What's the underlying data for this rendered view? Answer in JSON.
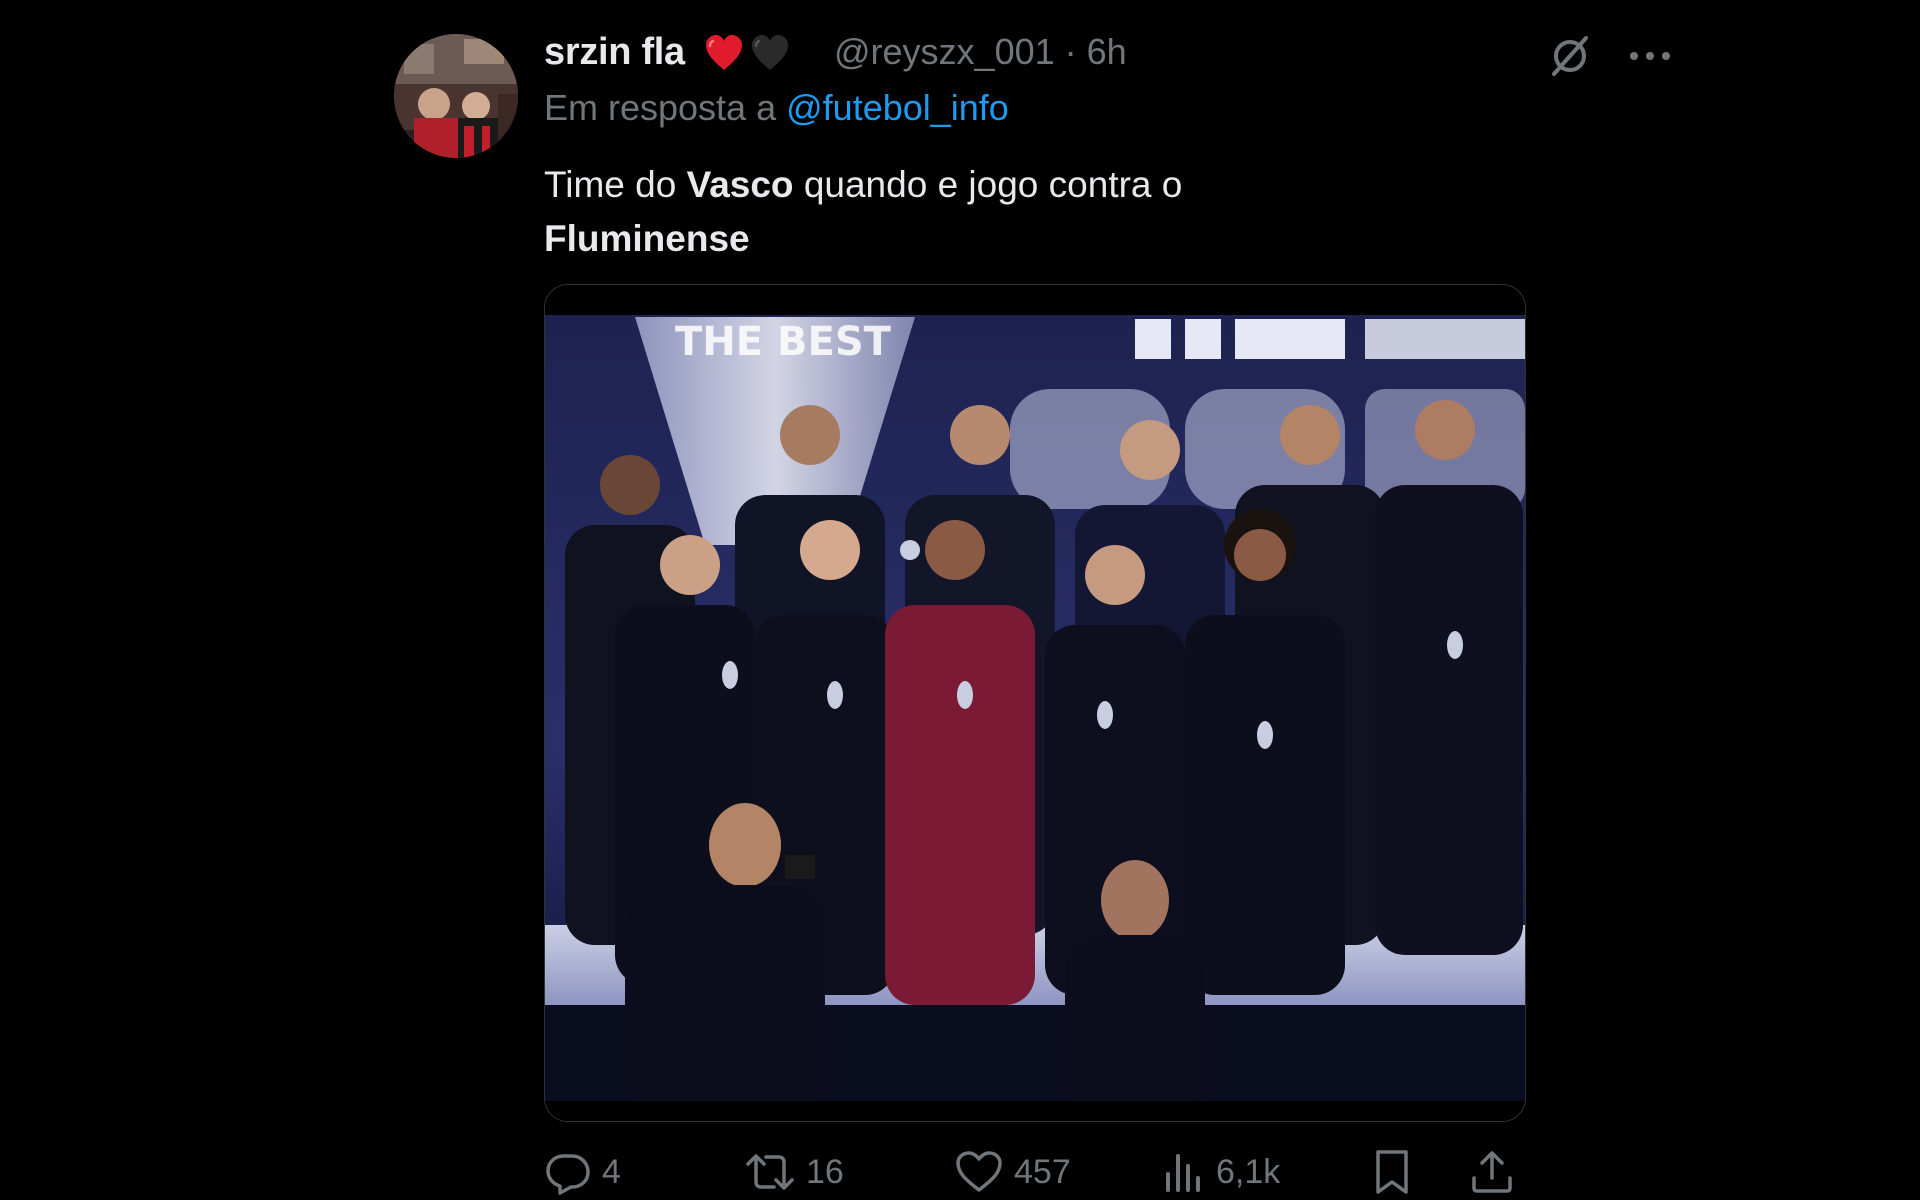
{
  "tweet": {
    "display_name": "srzin fla",
    "name_emojis": [
      "red-heart",
      "black-heart"
    ],
    "handle_time": "@reyszx_001 · 6h",
    "reply_prefix": "Em resposta a",
    "reply_to": "@futebol_info",
    "text": {
      "part1": "Time do ",
      "bold1": "Vasco",
      "part2": " quando e jogo contra o ",
      "bold2": "Fluminense"
    },
    "media": {
      "icon": "photo",
      "backdrop_text": "THE BEST"
    },
    "actions": {
      "reply_count": "4",
      "repost_count": "16",
      "like_count": "457",
      "views_count": "6,1k"
    }
  },
  "icons": {
    "reply": "reply-icon",
    "repost": "repost-icon",
    "like": "heart-icon",
    "views": "analytics-icon",
    "bookmark": "bookmark-icon",
    "share": "share-icon",
    "grok": "grok-icon",
    "more": "more-icon"
  },
  "colors": {
    "background": "#000000",
    "text": "#e7e9ea",
    "secondary": "#71767b",
    "link": "#1d9bf0",
    "heart": "#e0245e"
  }
}
